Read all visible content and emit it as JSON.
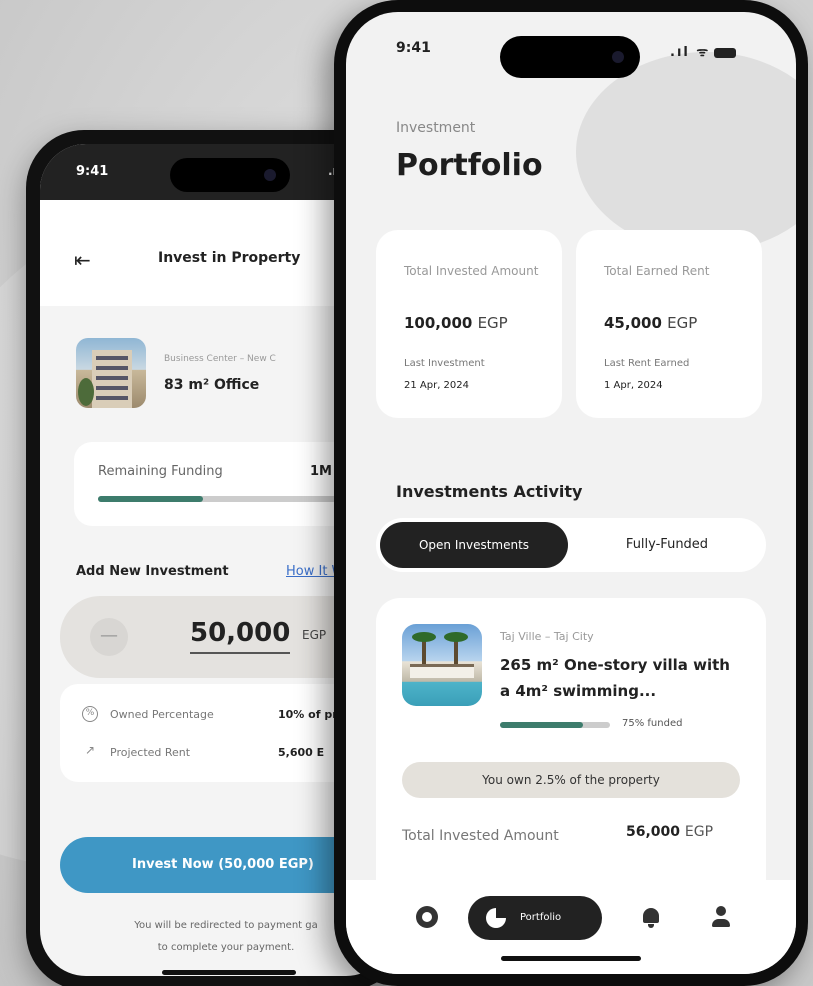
{
  "back_phone": {
    "status_time": "9:41",
    "status_signal": ".ıl",
    "header": {
      "back_icon": "double-arrow-left-icon",
      "title": "Invest in Property"
    },
    "property": {
      "location": "Business Center – New C",
      "name": "83 m² Office"
    },
    "funding": {
      "label": "Remaining Funding",
      "value": "1M",
      "progress_percent": 35
    },
    "investment": {
      "section_label": "Add New Investment",
      "how_link": "How It W",
      "minus_label": "—",
      "amount": "50,000",
      "currency": "EGP"
    },
    "metrics": [
      {
        "icon": "percentage-icon",
        "label": "Owned Percentage",
        "value": "10% of pr"
      },
      {
        "icon": "trend-up-icon",
        "label": "Projected Rent",
        "value": "5,600 E"
      }
    ],
    "invest_button": "Invest Now (50,000 EGP)",
    "redirect_note_line1": "You will be redirected to payment ga",
    "redirect_note_line2": "to complete your payment."
  },
  "front_phone": {
    "status_time": "9:41",
    "status_icons": ".ıl ᯤ",
    "eyebrow": "Investment",
    "title": "Portfolio",
    "stats": [
      {
        "label": "Total Invested Amount",
        "value": "100,000",
        "currency": "EGP",
        "sub_label": "Last Investment",
        "date": "21 Apr, 2024"
      },
      {
        "label": "Total Earned Rent",
        "value": "45,000",
        "currency": "EGP",
        "sub_label": "Last Rent Earned",
        "date": "1 Apr, 2024"
      }
    ],
    "activity": {
      "title": "Investments Activity",
      "tabs": [
        {
          "label": "Open Investments",
          "active": true
        },
        {
          "label": "Fully-Funded",
          "active": false
        }
      ]
    },
    "investment_card": {
      "location": "Taj Ville – Taj City",
      "name": "265 m² One-story villa with a 4m² swimming...",
      "funded_percent": 75,
      "funded_label": "75% funded",
      "ownership": "You own 2.5% of the property",
      "total_label": "Total Invested Amount",
      "total_value": "56,000",
      "total_currency": "EGP"
    },
    "bottom_nav": {
      "items": [
        {
          "icon": "explore-icon"
        },
        {
          "icon": "pie-chart-icon",
          "label": "Portfolio",
          "active": true
        },
        {
          "icon": "bell-icon"
        },
        {
          "icon": "profile-icon"
        }
      ]
    }
  },
  "colors": {
    "accent_green": "#3d7c6c",
    "invest_button_blue": "#3f97c5",
    "dark": "#222222",
    "link_blue": "#3b6fc9"
  }
}
